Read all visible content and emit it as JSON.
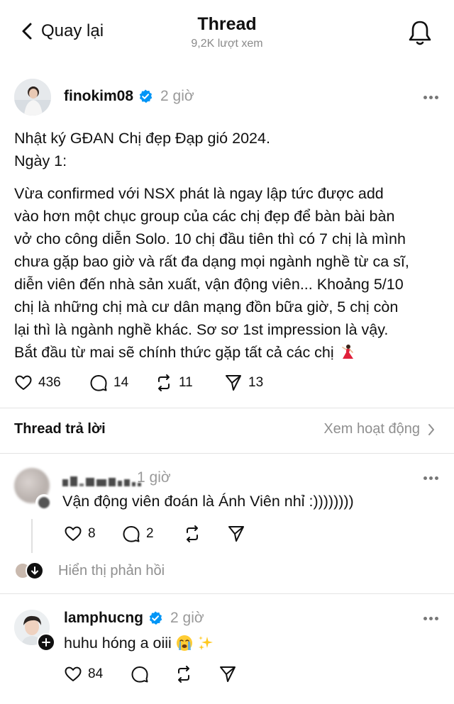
{
  "header": {
    "back_label": "Quay lại",
    "title": "Thread",
    "views": "9,2K lượt xem"
  },
  "post": {
    "author": "finokim08",
    "time": "2 giờ",
    "lines": [
      "Nhật ký GĐAN Chị đẹp Đạp gió 2024.",
      "Ngày 1:",
      "Vừa confirmed với NSX phát là ngay lập tức được add",
      "vào hơn một chục group của các chị đẹp để bàn bài bàn",
      "vở cho công diễn Solo. 10 chị đầu tiên thì có 7 chị là mình",
      "chưa gặp bao giờ và rất đa dạng mọi ngành nghề từ ca sĩ,",
      "diễn viên đến nhà sản xuất, vận động viên... Khoảng 5/10",
      "chị là những chị mà cư dân mạng đồn bữa giờ, 5 chị còn",
      "lại thì là ngành nghề khác. Sơ sơ 1st impression là vậy.",
      "Bắt đầu từ mai sẽ chính thức gặp tất cả các chị"
    ],
    "likes": "436",
    "comments": "14",
    "reposts": "11",
    "shares": "13"
  },
  "replies_section": {
    "title": "Thread trả lời",
    "activity_link": "Xem hoạt động"
  },
  "reply1": {
    "time": "1 giờ",
    "text": "Vận động viên đoán là Ánh Viên nhỉ :))))))))",
    "likes": "8",
    "comments": "2",
    "show_replies": "Hiển thị phản hồi"
  },
  "reply2": {
    "author": "lamphucng",
    "time": "2 giờ",
    "text": "huhu hóng a oiii",
    "likes": "84"
  },
  "colors": {
    "verified": "#0095f6",
    "muted": "#8f8f8f",
    "text": "#101010"
  }
}
